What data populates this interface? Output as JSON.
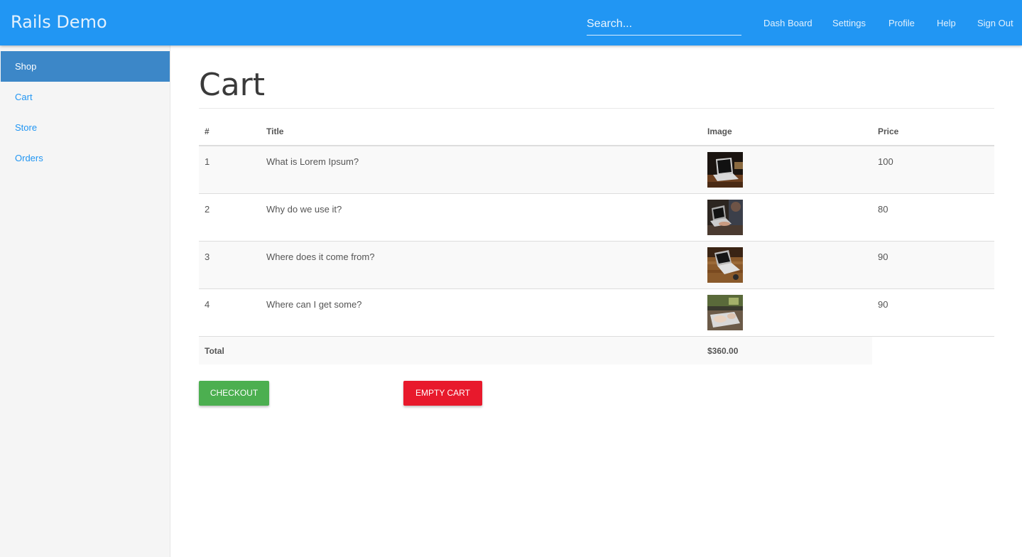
{
  "header": {
    "brand": "Rails Demo",
    "search_placeholder": "Search...",
    "nav": [
      "Dash Board",
      "Settings",
      "Profile",
      "Help",
      "Sign Out"
    ],
    "color": "#2196f3"
  },
  "sidebar": {
    "items": [
      {
        "label": "Shop",
        "active": true
      },
      {
        "label": "Cart",
        "active": false
      },
      {
        "label": "Store",
        "active": false
      },
      {
        "label": "Orders",
        "active": false
      }
    ]
  },
  "main": {
    "title": "Cart",
    "columns": [
      "#",
      "Title",
      "Image",
      "Price"
    ],
    "rows": [
      {
        "num": "1",
        "title": "What is Lorem Ipsum?",
        "image": "laptop-on-desk",
        "price": "100"
      },
      {
        "num": "2",
        "title": "Why do we use it?",
        "image": "person-using-laptop",
        "price": "80"
      },
      {
        "num": "3",
        "title": "Where does it come from?",
        "image": "laptop-on-wood-table",
        "price": "90"
      },
      {
        "num": "4",
        "title": "Where can I get some?",
        "image": "hands-on-keyboard",
        "price": "90"
      }
    ],
    "total_label": "Total",
    "total_value": "$360.00"
  },
  "actions": {
    "checkout_label": "CHECKOUT",
    "checkout_color": "#4caf50",
    "empty_label": "EMPTY CART",
    "empty_color": "#e8192c"
  }
}
